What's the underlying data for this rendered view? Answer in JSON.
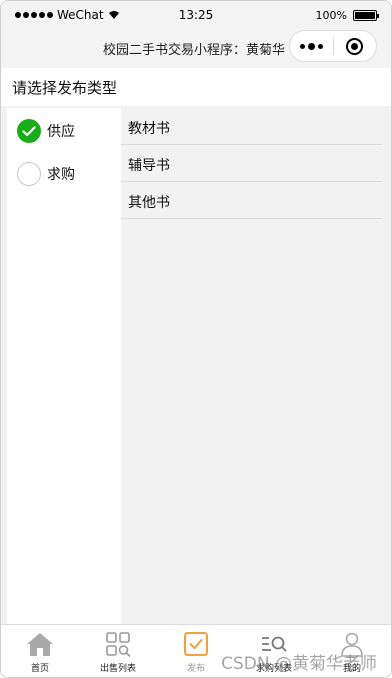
{
  "status_bar": {
    "carrier": "WeChat",
    "time": "13:25",
    "battery": "100%"
  },
  "nav": {
    "title": "校园二手书交易小程序：黄菊华"
  },
  "heading": "请选择发布类型",
  "publish_types": [
    {
      "label": "供应",
      "selected": true
    },
    {
      "label": "求购",
      "selected": false
    }
  ],
  "book_categories": [
    "教材书",
    "辅导书",
    "其他书"
  ],
  "tabbar": {
    "tabs": [
      {
        "label": "首页",
        "icon": "home-icon"
      },
      {
        "label": "出售列表",
        "icon": "grid-search-icon"
      },
      {
        "label": "发布",
        "icon": "publish-check-icon",
        "active": true
      },
      {
        "label": "求购列表",
        "icon": "list-search-icon"
      },
      {
        "label": "我的",
        "icon": "user-icon"
      }
    ]
  },
  "watermark": "CSDN @黄菊华老师",
  "colors": {
    "accent_green": "#1aad19",
    "active_tab_orange": "#f0a040",
    "background_gray": "#f2f2f2"
  }
}
